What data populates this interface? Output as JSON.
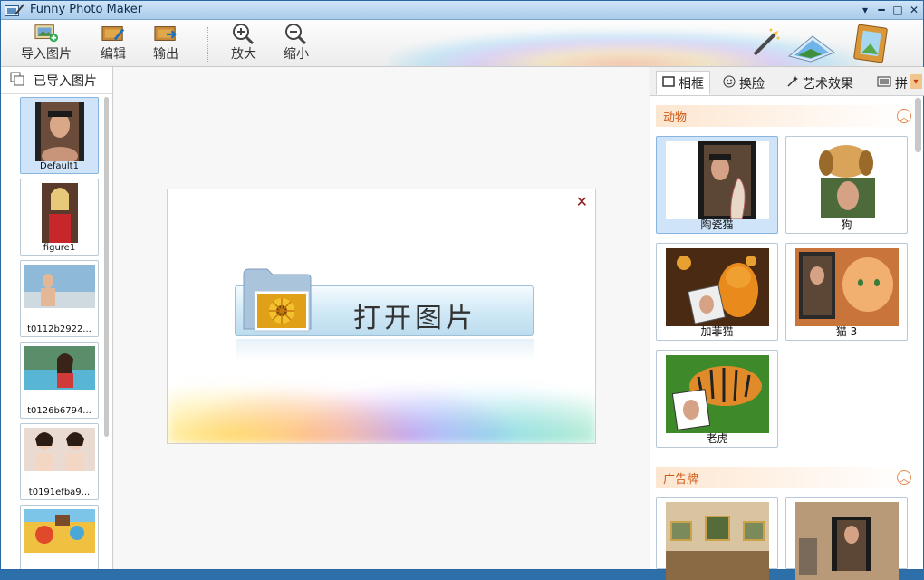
{
  "window": {
    "title": "Funny Photo Maker",
    "controls": {
      "menu": "▾",
      "minimize": "━",
      "maximize": "□",
      "close": "✕"
    }
  },
  "toolbar": {
    "import_label": "导入图片",
    "edit_label": "编辑",
    "export_label": "输出",
    "zoom_in_label": "放大",
    "zoom_out_label": "缩小"
  },
  "left_panel": {
    "header": "已导入图片",
    "images": [
      {
        "caption": "Default1",
        "selected": true
      },
      {
        "caption": "figure1"
      },
      {
        "caption": "t0112b2922..."
      },
      {
        "caption": "t0126b6794..."
      },
      {
        "caption": "t0191efba9..."
      },
      {
        "caption": ""
      }
    ]
  },
  "canvas": {
    "open_button_label": "打开图片",
    "close_symbol": "✕"
  },
  "right_panel": {
    "tabs": [
      {
        "label": "相框",
        "icon": "frame-icon",
        "active": true
      },
      {
        "label": "换脸",
        "icon": "smiley-icon"
      },
      {
        "label": "艺术效果",
        "icon": "magic-wand-icon"
      },
      {
        "label": "拼",
        "icon": "collage-icon"
      }
    ],
    "more_symbol": "▾",
    "sections": [
      {
        "title": "动物",
        "collapse_symbol": "︿",
        "items": [
          {
            "label": "陶瓷猫",
            "selected": true
          },
          {
            "label": "狗"
          },
          {
            "label": "加菲猫"
          },
          {
            "label": "猫 3"
          },
          {
            "label": "老虎"
          }
        ]
      },
      {
        "title": "广告牌",
        "collapse_symbol": "︿",
        "items": [
          {
            "label": ""
          },
          {
            "label": ""
          }
        ]
      }
    ]
  },
  "colors": {
    "title_bar": "#a9cbea",
    "selection": "#cfe4f8",
    "section_text": "#d05c16",
    "close_x": "#8b1a1a"
  }
}
